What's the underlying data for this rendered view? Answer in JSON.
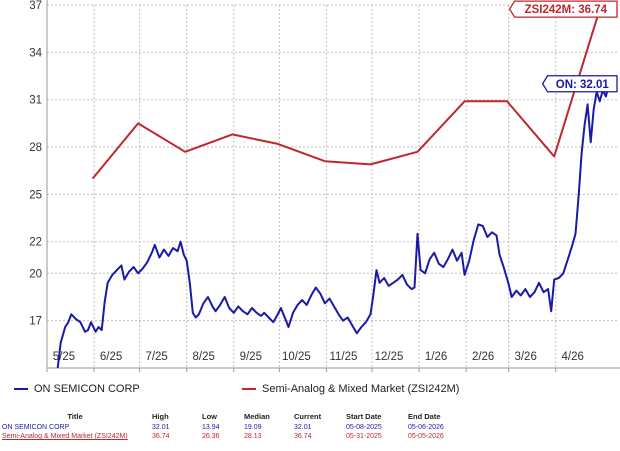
{
  "chart_data": {
    "type": "line",
    "title": "",
    "xlabel": "",
    "ylabel": "",
    "ylim": [
      14,
      37
    ],
    "xlim": [
      "2025-05-01",
      "2026-05-12"
    ],
    "y_ticks": [
      17,
      20,
      22,
      25,
      28,
      31,
      34,
      37
    ],
    "x_ticks": [
      {
        "label": "5/25",
        "date": "2025-05-01"
      },
      {
        "label": "6/25",
        "date": "2025-06-01"
      },
      {
        "label": "7/25",
        "date": "2025-07-01"
      },
      {
        "label": "8/25",
        "date": "2025-08-01"
      },
      {
        "label": "9/25",
        "date": "2025-09-01"
      },
      {
        "label": "10/25",
        "date": "2025-10-01"
      },
      {
        "label": "11/25",
        "date": "2025-11-01"
      },
      {
        "label": "12/25",
        "date": "2025-12-01"
      },
      {
        "label": "1/26",
        "date": "2026-01-01"
      },
      {
        "label": "2/26",
        "date": "2026-02-01"
      },
      {
        "label": "3/26",
        "date": "2026-03-01"
      },
      {
        "label": "4/26",
        "date": "2026-04-01"
      }
    ],
    "grid": true,
    "legend_position": "bottom",
    "series": [
      {
        "name": "ON SEMICON CORP",
        "color": "#1a1aa6",
        "end_label": "ON: 32.01",
        "points": [
          [
            "2025-05-08",
            13.94
          ],
          [
            "2025-05-10",
            15.6
          ],
          [
            "2025-05-13",
            16.6
          ],
          [
            "2025-05-15",
            16.9
          ],
          [
            "2025-05-17",
            17.4
          ],
          [
            "2025-05-20",
            17.1
          ],
          [
            "2025-05-23",
            16.9
          ],
          [
            "2025-05-26",
            16.3
          ],
          [
            "2025-05-28",
            16.4
          ],
          [
            "2025-05-30",
            16.9
          ],
          [
            "2025-06-02",
            16.3
          ],
          [
            "2025-06-04",
            16.6
          ],
          [
            "2025-06-06",
            16.4
          ],
          [
            "2025-06-08",
            18.2
          ],
          [
            "2025-06-10",
            19.4
          ],
          [
            "2025-06-13",
            19.9
          ],
          [
            "2025-06-16",
            20.2
          ],
          [
            "2025-06-19",
            20.5
          ],
          [
            "2025-06-21",
            19.6
          ],
          [
            "2025-06-24",
            20.1
          ],
          [
            "2025-06-27",
            20.4
          ],
          [
            "2025-06-30",
            20.0
          ],
          [
            "2025-07-03",
            20.3
          ],
          [
            "2025-07-06",
            20.7
          ],
          [
            "2025-07-09",
            21.3
          ],
          [
            "2025-07-11",
            21.8
          ],
          [
            "2025-07-14",
            21.0
          ],
          [
            "2025-07-17",
            21.5
          ],
          [
            "2025-07-20",
            21.1
          ],
          [
            "2025-07-23",
            21.6
          ],
          [
            "2025-07-26",
            21.4
          ],
          [
            "2025-07-28",
            22.0
          ],
          [
            "2025-07-30",
            21.2
          ],
          [
            "2025-08-01",
            20.8
          ],
          [
            "2025-08-03",
            19.4
          ],
          [
            "2025-08-05",
            17.5
          ],
          [
            "2025-08-07",
            17.2
          ],
          [
            "2025-08-09",
            17.4
          ],
          [
            "2025-08-12",
            18.1
          ],
          [
            "2025-08-15",
            18.5
          ],
          [
            "2025-08-18",
            17.9
          ],
          [
            "2025-08-20",
            17.6
          ],
          [
            "2025-08-23",
            18.0
          ],
          [
            "2025-08-26",
            18.5
          ],
          [
            "2025-08-29",
            17.8
          ],
          [
            "2025-09-01",
            17.5
          ],
          [
            "2025-09-04",
            17.9
          ],
          [
            "2025-09-07",
            17.6
          ],
          [
            "2025-09-10",
            17.4
          ],
          [
            "2025-09-13",
            17.8
          ],
          [
            "2025-09-16",
            17.5
          ],
          [
            "2025-09-19",
            17.3
          ],
          [
            "2025-09-21",
            17.5
          ],
          [
            "2025-09-24",
            17.2
          ],
          [
            "2025-09-27",
            16.9
          ],
          [
            "2025-09-30",
            17.4
          ],
          [
            "2025-10-02",
            17.8
          ],
          [
            "2025-10-05",
            17.1
          ],
          [
            "2025-10-07",
            16.6
          ],
          [
            "2025-10-10",
            17.5
          ],
          [
            "2025-10-13",
            18.0
          ],
          [
            "2025-10-16",
            18.3
          ],
          [
            "2025-10-19",
            18.0
          ],
          [
            "2025-10-22",
            18.6
          ],
          [
            "2025-10-25",
            19.1
          ],
          [
            "2025-10-28",
            18.7
          ],
          [
            "2025-10-31",
            18.1
          ],
          [
            "2025-11-03",
            18.4
          ],
          [
            "2025-11-06",
            17.9
          ],
          [
            "2025-11-09",
            17.4
          ],
          [
            "2025-11-12",
            17.0
          ],
          [
            "2025-11-15",
            17.2
          ],
          [
            "2025-11-18",
            16.7
          ],
          [
            "2025-11-21",
            16.2
          ],
          [
            "2025-11-24",
            16.6
          ],
          [
            "2025-11-27",
            16.9
          ],
          [
            "2025-11-30",
            17.4
          ],
          [
            "2025-12-02",
            18.7
          ],
          [
            "2025-12-04",
            20.2
          ],
          [
            "2025-12-06",
            19.4
          ],
          [
            "2025-12-09",
            19.7
          ],
          [
            "2025-12-12",
            19.2
          ],
          [
            "2025-12-15",
            19.4
          ],
          [
            "2025-12-18",
            19.6
          ],
          [
            "2025-12-21",
            19.9
          ],
          [
            "2025-12-24",
            19.3
          ],
          [
            "2025-12-27",
            19.0
          ],
          [
            "2025-12-29",
            19.1
          ],
          [
            "2025-12-31",
            22.5
          ],
          [
            "2026-01-02",
            20.2
          ],
          [
            "2026-01-05",
            20.0
          ],
          [
            "2026-01-08",
            20.9
          ],
          [
            "2026-01-11",
            21.3
          ],
          [
            "2026-01-14",
            20.6
          ],
          [
            "2026-01-17",
            20.4
          ],
          [
            "2026-01-20",
            20.9
          ],
          [
            "2026-01-23",
            21.5
          ],
          [
            "2026-01-26",
            20.8
          ],
          [
            "2026-01-29",
            21.3
          ],
          [
            "2026-01-31",
            19.9
          ],
          [
            "2026-02-03",
            20.8
          ],
          [
            "2026-02-06",
            22.1
          ],
          [
            "2026-02-09",
            23.1
          ],
          [
            "2026-02-12",
            23.0
          ],
          [
            "2026-02-15",
            22.3
          ],
          [
            "2026-02-18",
            22.6
          ],
          [
            "2026-02-21",
            22.4
          ],
          [
            "2026-02-23",
            21.2
          ],
          [
            "2026-02-26",
            20.3
          ],
          [
            "2026-03-01",
            19.3
          ],
          [
            "2026-03-03",
            18.5
          ],
          [
            "2026-03-06",
            18.9
          ],
          [
            "2026-03-09",
            18.6
          ],
          [
            "2026-03-12",
            19.0
          ],
          [
            "2026-03-15",
            18.5
          ],
          [
            "2026-03-18",
            18.8
          ],
          [
            "2026-03-21",
            19.4
          ],
          [
            "2026-03-24",
            18.8
          ],
          [
            "2026-03-27",
            19.0
          ],
          [
            "2026-03-29",
            17.6
          ],
          [
            "2026-03-31",
            19.6
          ],
          [
            "2026-04-03",
            19.7
          ],
          [
            "2026-04-06",
            20.0
          ],
          [
            "2026-04-09",
            20.9
          ],
          [
            "2026-04-12",
            21.8
          ],
          [
            "2026-04-14",
            22.5
          ],
          [
            "2026-04-16",
            24.8
          ],
          [
            "2026-04-18",
            27.6
          ],
          [
            "2026-04-20",
            29.4
          ],
          [
            "2026-04-22",
            30.7
          ],
          [
            "2026-04-24",
            28.3
          ],
          [
            "2026-04-26",
            30.4
          ],
          [
            "2026-04-28",
            31.5
          ],
          [
            "2026-04-30",
            30.9
          ],
          [
            "2026-05-02",
            31.6
          ],
          [
            "2026-05-04",
            31.2
          ],
          [
            "2026-05-06",
            32.01
          ]
        ]
      },
      {
        "name": "Semi-Analog & Mixed Market (ZSI242M)",
        "color": "#c0272d",
        "end_label": "ZSI242M: 36.74",
        "points": [
          [
            "2025-05-31",
            26.0
          ],
          [
            "2025-06-30",
            29.5
          ],
          [
            "2025-07-31",
            27.7
          ],
          [
            "2025-08-31",
            28.8
          ],
          [
            "2025-09-30",
            28.2
          ],
          [
            "2025-10-31",
            27.1
          ],
          [
            "2025-11-30",
            26.9
          ],
          [
            "2025-12-31",
            27.7
          ],
          [
            "2026-01-31",
            30.9
          ],
          [
            "2026-02-28",
            30.9
          ],
          [
            "2026-03-31",
            27.4
          ],
          [
            "2026-04-30",
            36.74
          ]
        ]
      }
    ]
  },
  "legend": {
    "on_label": "ON SEMICON CORP",
    "zsi_label": "Semi-Analog & Mixed Market (ZSI242M)"
  },
  "table": {
    "headers": {
      "title": "Title",
      "high": "High",
      "low": "Low",
      "median": "Median",
      "current": "Current",
      "start": "Start Date",
      "end": "End Date"
    },
    "rows": [
      {
        "title": "ON SEMICON CORP",
        "high": "32.01",
        "low": "13.94",
        "median": "19.09",
        "current": "32.01",
        "start": "05-08-2025",
        "end": "05-06-2026"
      },
      {
        "title": "Semi-Analog & Mixed Market (ZSI242M)",
        "high": "36.74",
        "low": "26.36",
        "median": "28.13",
        "current": "36.74",
        "start": "05-31-2025",
        "end": "05-05-2026"
      }
    ]
  }
}
